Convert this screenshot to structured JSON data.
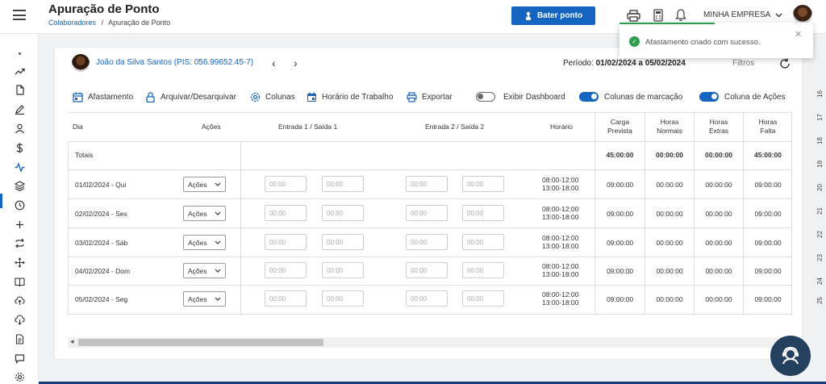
{
  "header": {
    "title": "Apuração de Ponto",
    "breadcrumb": {
      "link": "Colaboradores",
      "separator": "/",
      "current": "Apuração de Ponto"
    },
    "bater_ponto": "Bater ponto",
    "company": "MINHA EMPRESA"
  },
  "toast": {
    "message": "Afastamento criado com sucesso."
  },
  "employee": {
    "name": "João da Silva Santos (PIS: 056.99652.45-7)"
  },
  "periodo": {
    "label": "Período:",
    "value": "01/02/2024 a 05/02/2024"
  },
  "filtros": "Filtros",
  "toolbar": {
    "afastamento": "Afastamento",
    "arquivar": "Arquivar/Desarquivar",
    "colunas": "Colunas",
    "horario": "Horário de Trabalho",
    "exportar": "Exportar",
    "exibir_dashboard": "Exibir Dashboard",
    "colunas_marcacao": "Colunas de marcação",
    "coluna_acoes": "Coluna de Ações"
  },
  "toggles": {
    "exibir_dashboard": false,
    "colunas_marcacao": true,
    "coluna_acoes": true
  },
  "table": {
    "headers": {
      "dia": "Dia",
      "acoes": "Ações",
      "entrada1": "Entrada 1 / Saída 1",
      "entrada2": "Entrada 2 / Saída 2",
      "horario": "Horário",
      "carga_l1": "Carga",
      "carga_l2": "Prevista",
      "normais_l1": "Horas",
      "normais_l2": "Normais",
      "extras_l1": "Horas",
      "extras_l2": "Extras",
      "falta_l1": "Horas",
      "falta_l2": "Falta"
    },
    "totals": {
      "label": "Totais",
      "carga": "45:00:00",
      "normais": "00:00:00",
      "extras": "00:00:00",
      "falta": "45:00:00"
    },
    "time_placeholder": "00:00",
    "acoes_label": "Ações",
    "rows": [
      {
        "dia": "01/02/2024 - Qui",
        "horario_1": "08:00-12:00",
        "horario_2": "13:00-18:00",
        "carga": "09:00:00",
        "normais": "00:00:00",
        "extras": "00:00:00",
        "falta": "09:00:00"
      },
      {
        "dia": "02/02/2024 - Sex",
        "horario_1": "08:00-12:00",
        "horario_2": "13:00-18:00",
        "carga": "09:00:00",
        "normais": "00:00:00",
        "extras": "00:00:00",
        "falta": "09:00:00"
      },
      {
        "dia": "03/02/2024 - Sáb",
        "horario_1": "08:00-12:00",
        "horario_2": "13:00-18:00",
        "carga": "09:00:00",
        "normais": "00:00:00",
        "extras": "00:00:00",
        "falta": "09:00:00"
      },
      {
        "dia": "04/02/2024 - Dom",
        "horario_1": "08:00-12:00",
        "horario_2": "13:00-18:00",
        "carga": "09:00:00",
        "normais": "00:00:00",
        "extras": "00:00:00",
        "falta": "09:00:00"
      },
      {
        "dia": "05/02/2024 - Seg",
        "horario_1": "08:00-12:00",
        "horario_2": "13:00-18:00",
        "carga": "09:00:00",
        "normais": "00:00:00",
        "extras": "00:00:00",
        "falta": "09:00:00"
      }
    ]
  },
  "ruler": [
    "16",
    "17",
    "18",
    "19",
    "20",
    "21",
    "22",
    "23",
    "24",
    "25"
  ],
  "icons": {
    "sidebar": [
      "dot-icon",
      "trending-icon",
      "file-icon",
      "pen-icon",
      "user-icon",
      "dollar-icon",
      "activity-icon",
      "layers-icon",
      "clock-icon",
      "plus-icon",
      "repeat-icon",
      "move-icon",
      "book-icon",
      "upload-cloud-icon",
      "download-cloud-icon",
      "document-icon",
      "chat-icon",
      "settings-icon"
    ]
  },
  "colors": {
    "primary": "#1565c0",
    "success": "#2e9e4a",
    "help": "#23405e"
  }
}
